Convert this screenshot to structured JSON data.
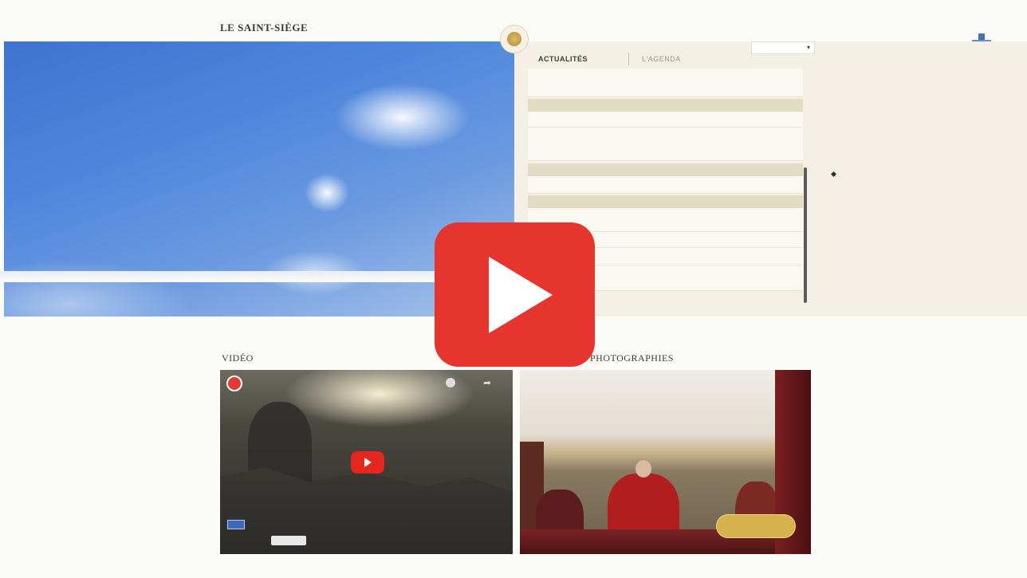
{
  "header": {
    "site_title": "LE SAINT-SIÈGE",
    "lang": "",
    "lang_alt": ""
  },
  "news": {
    "tabs": [
      "ACTUALITÉS",
      "L'AGENDA"
    ],
    "month_select": "",
    "items": []
  },
  "sections": {
    "video_label": "VIDÉO",
    "photo_label": "PHOTOGRAPHIES"
  },
  "video": {
    "watch_on": ""
  },
  "photo": {
    "gallery_button": ""
  },
  "colors": {
    "play_button": "#e6342f",
    "date_bar": "#e3dcc4",
    "panel_bg": "#f4f0e6"
  },
  "icons": {
    "play": "play-icon",
    "crest": "papal-crest-icon",
    "seal": "holy-see-seal-icon"
  }
}
